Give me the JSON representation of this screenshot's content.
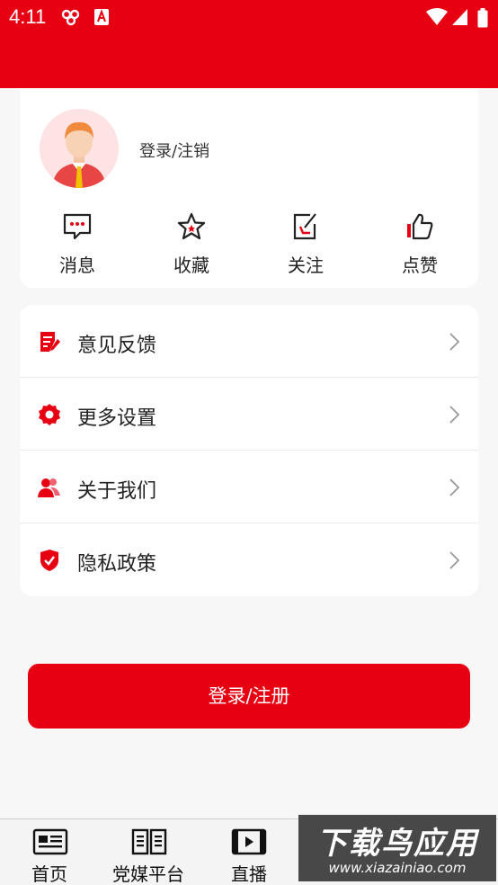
{
  "status_bar": {
    "time": "4:11",
    "icons": [
      "sync-icon",
      "app-notification-icon",
      "wifi-icon",
      "signal-icon",
      "battery-icon"
    ]
  },
  "profile": {
    "login_text": "登录/注销",
    "avatar_icon": "user-avatar-icon"
  },
  "quick_actions": [
    {
      "label": "消息",
      "icon": "message-icon"
    },
    {
      "label": "收藏",
      "icon": "star-icon"
    },
    {
      "label": "关注",
      "icon": "edit-icon"
    },
    {
      "label": "点赞",
      "icon": "thumbs-up-icon"
    }
  ],
  "menu": [
    {
      "label": "意见反馈",
      "icon": "feedback-icon"
    },
    {
      "label": "更多设置",
      "icon": "gear-icon"
    },
    {
      "label": "关于我们",
      "icon": "users-icon"
    },
    {
      "label": "隐私政策",
      "icon": "shield-icon"
    }
  ],
  "login_button": "登录/注册",
  "tabbar": [
    {
      "label": "首页",
      "icon": "news-icon"
    },
    {
      "label": "党媒平台",
      "icon": "book-icon"
    },
    {
      "label": "直播",
      "icon": "video-icon"
    }
  ],
  "watermark": {
    "title": "下载鸟应用",
    "url": "www.xiazainiao.com"
  },
  "colors": {
    "brand_red": "#e60012",
    "background": "#f7f7f7"
  }
}
